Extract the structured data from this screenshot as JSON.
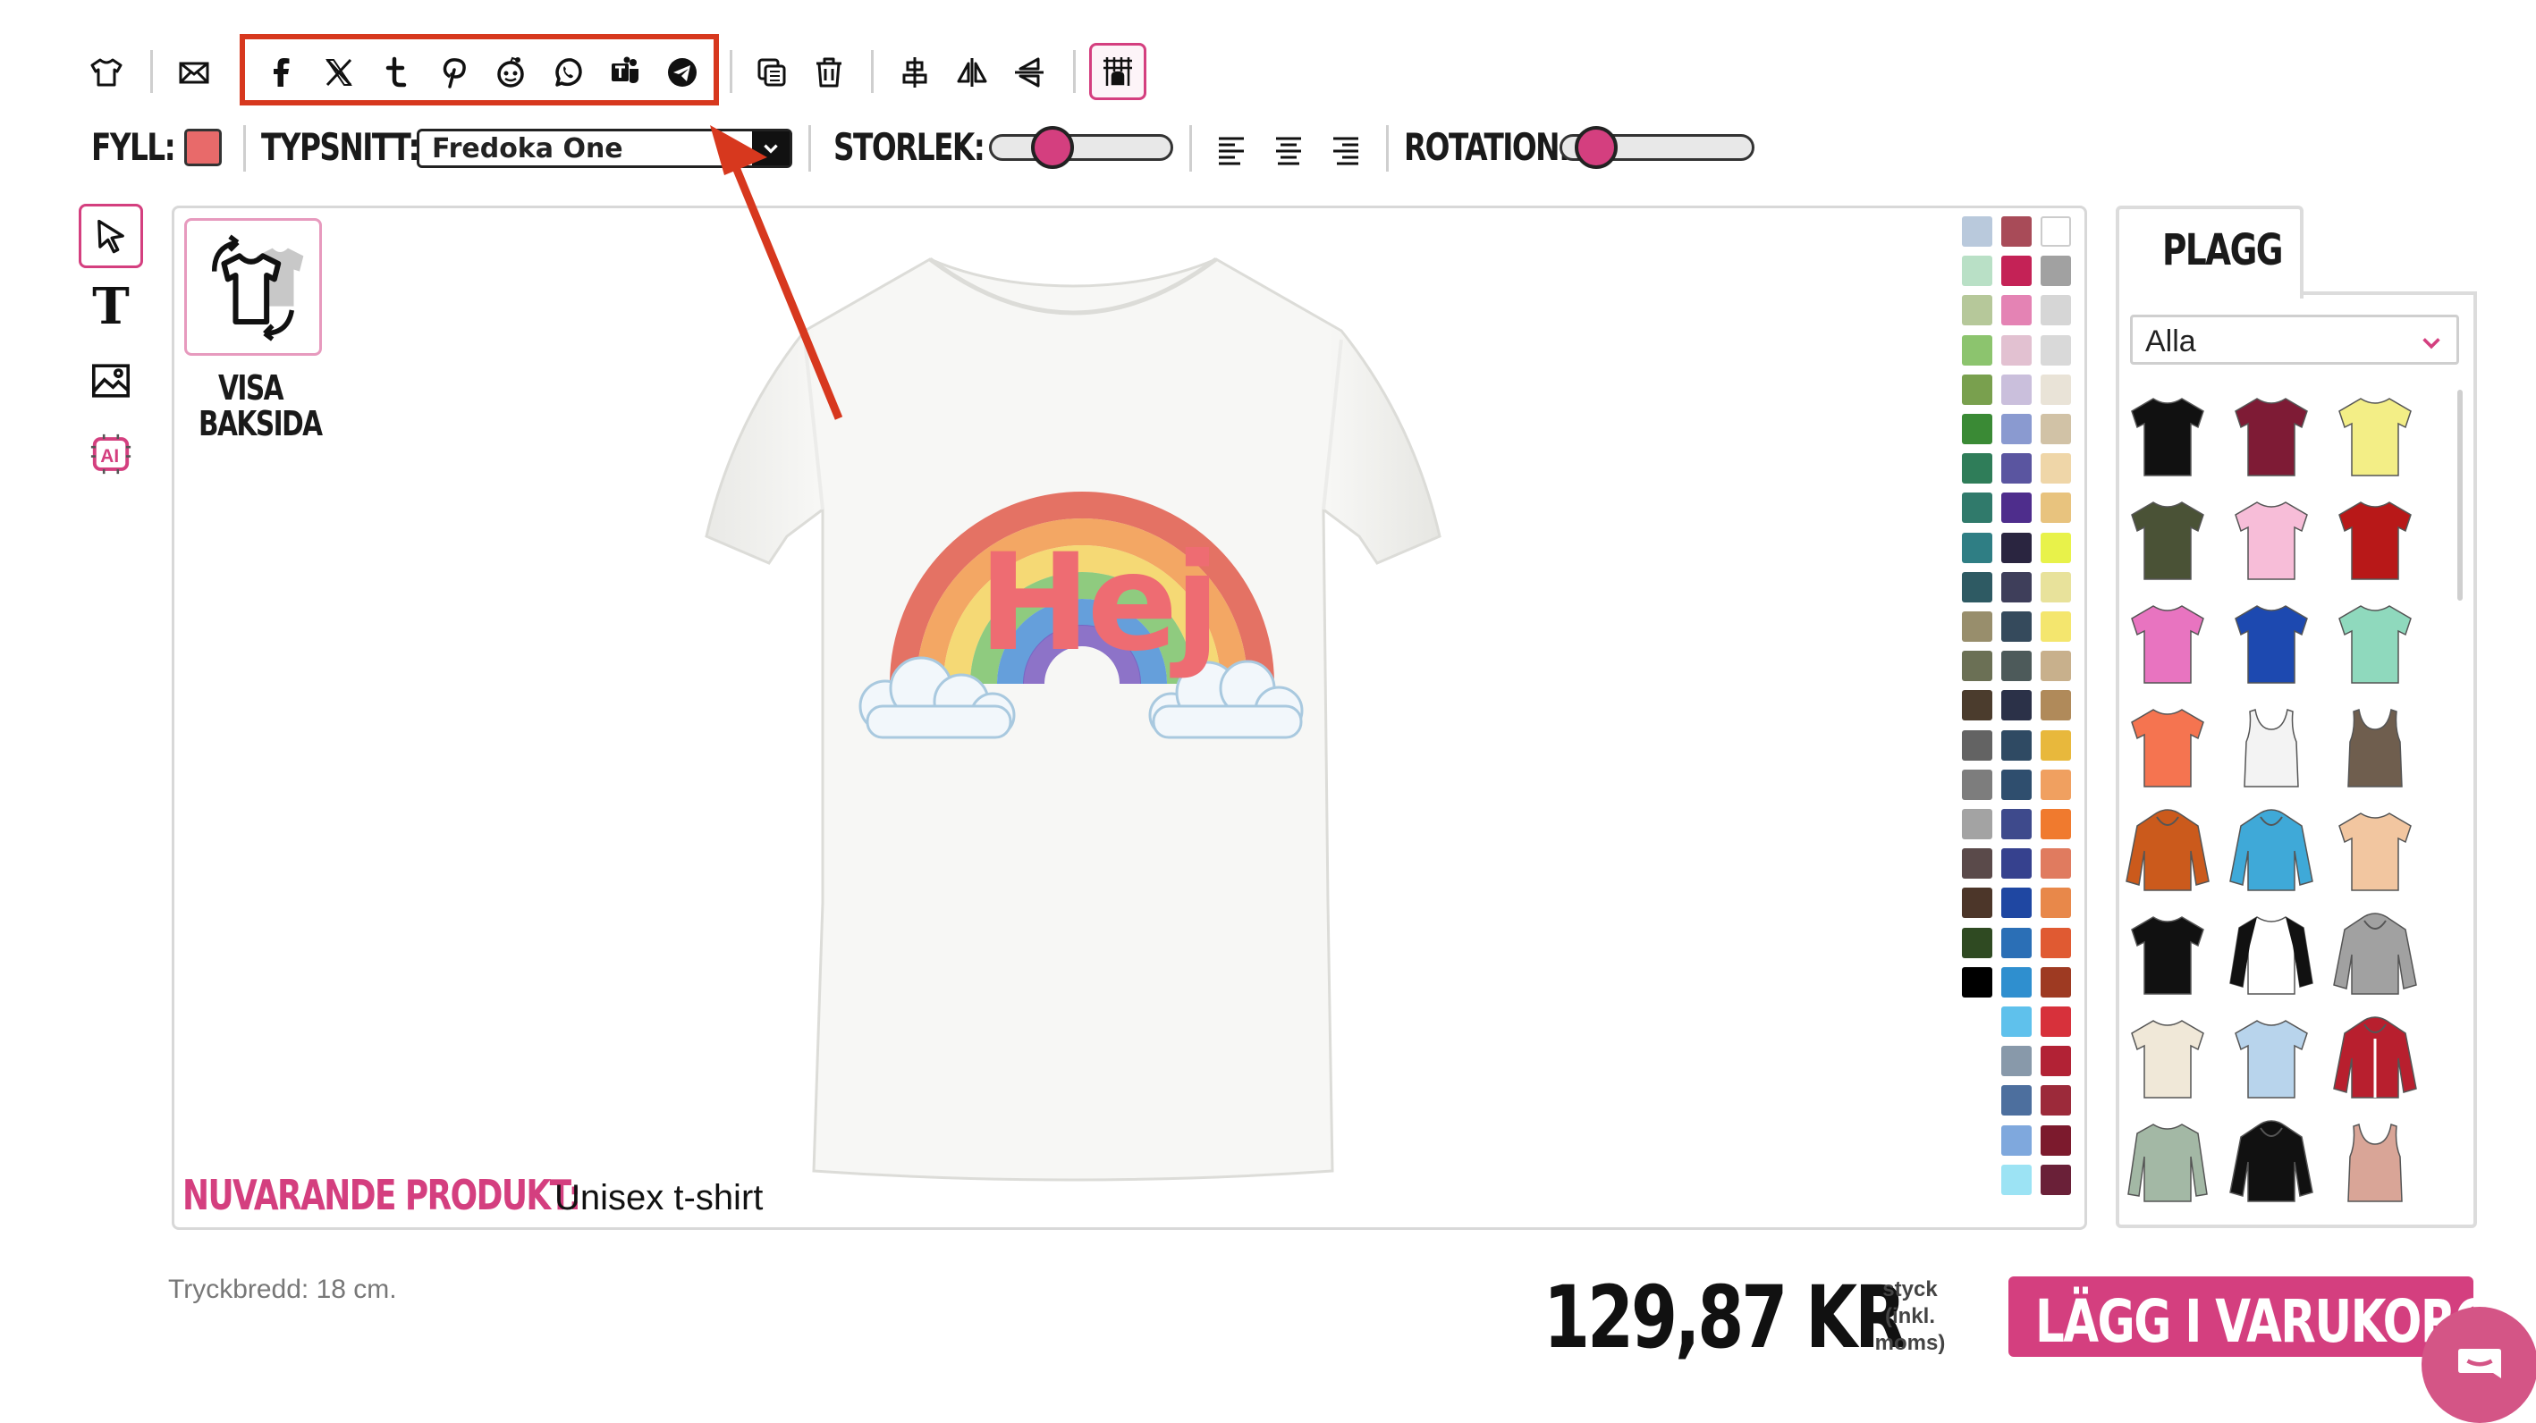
{
  "toolbar": {
    "share_icons": [
      "facebook-icon",
      "x-icon",
      "tumblr-icon",
      "pinterest-icon",
      "reddit-icon",
      "whatsapp-icon",
      "teams-icon",
      "telegram-icon"
    ]
  },
  "options": {
    "fill_label": "FYLL:",
    "fill_color": "#e86a6a",
    "font_label": "TYPSNITT:",
    "font_value": "Fredoka One",
    "size_label": "STORLEK:",
    "size_value": 0.3,
    "rotation_label": "ROTATION:",
    "rotation_value": 0.1
  },
  "canvas": {
    "back_label_line1": "VISA",
    "back_label_line2": "BAKSIDA",
    "design_text": "Hej",
    "product_label": "NUVARANDE PRODUKT:",
    "product_name": "Unisex t-shirt",
    "accent": "#d43f7f"
  },
  "palette": {
    "col1": [
      "#b9c9dc",
      "#b9e0c6",
      "#b6c89a",
      "#8cc46e",
      "#79a04e",
      "#3a8a35",
      "#2f7d59",
      "#307a6b",
      "#2f7e84",
      "#2e5a63",
      "#988e6c",
      "#6b7055",
      "#4b3c2d",
      "#636363",
      "#7d7d7d",
      "#a3a3a3",
      "#5a4a4a",
      "#4c3629",
      "#2f4a22",
      "#000000"
    ],
    "col2": [
      "#a84b58",
      "#c42256",
      "#e483b4",
      "#e2c1d1",
      "#cabfdc",
      "#8a9ad0",
      "#5a55a0",
      "#4e2d8c",
      "#2a2540",
      "#3e3e5a",
      "#354a5c",
      "#4d5a5a",
      "#2b3148",
      "#2f4a63",
      "#2f4e6e",
      "#3e4a8c",
      "#36418e",
      "#1f47a2",
      "#2b6fb6",
      "#2f8fcf",
      "#5fc1ec",
      "#8899aa",
      "#4d6f9e",
      "#7fa8dd",
      "#9ce3f4"
    ],
    "col3": [
      "#ffffff",
      "#a1a1a1",
      "#d6d6d6",
      "#d9d9d9",
      "#e9e3d7",
      "#d1c2a6",
      "#efd6a8",
      "#e8c37e",
      "#e8f24a",
      "#e8e29b",
      "#f4e66e",
      "#c8b08c",
      "#b08a5a",
      "#e8b83c",
      "#f0a060",
      "#f07a2e",
      "#e07b5f",
      "#e8884a",
      "#e05a32",
      "#9e3a22",
      "#d7313b",
      "#b22235",
      "#9c2a3a",
      "#7c1a2d",
      "#6a2038"
    ]
  },
  "garments_panel": {
    "tab_label": "PLAGG",
    "filter_value": "Alla",
    "items": [
      {
        "name": "black-tshirt",
        "color": "#111111",
        "kind": "tee"
      },
      {
        "name": "burgundy-tshirt",
        "color": "#7e1b35",
        "kind": "tee"
      },
      {
        "name": "yellow-tshirt",
        "color": "#f3ee86",
        "kind": "tee"
      },
      {
        "name": "olive-tshirt",
        "color": "#4a5236",
        "kind": "tee"
      },
      {
        "name": "pink-tshirt",
        "color": "#f7bdd8",
        "kind": "tee"
      },
      {
        "name": "red-tshirt",
        "color": "#b81818",
        "kind": "tee"
      },
      {
        "name": "magenta-tshirt",
        "color": "#e874c0",
        "kind": "tee"
      },
      {
        "name": "royal-blue-tshirt",
        "color": "#1d49b0",
        "kind": "tee"
      },
      {
        "name": "mint-tshirt",
        "color": "#8fd9bd",
        "kind": "tee"
      },
      {
        "name": "coral-tshirt",
        "color": "#f57450",
        "kind": "tee"
      },
      {
        "name": "white-tank",
        "color": "#f3f3f3",
        "kind": "tank"
      },
      {
        "name": "brown-tank",
        "color": "#6f5e4e",
        "kind": "tank"
      },
      {
        "name": "orange-hoodie",
        "color": "#cb5a1c",
        "kind": "hoodie"
      },
      {
        "name": "blue-hoodie",
        "color": "#3fa9d8",
        "kind": "hoodie"
      },
      {
        "name": "tiedye-tshirt",
        "color": "#f2c6a0",
        "kind": "tee"
      },
      {
        "name": "black-vneck",
        "color": "#111111",
        "kind": "tee"
      },
      {
        "name": "raglan-shirt",
        "color": "#ffffff",
        "kind": "raglan"
      },
      {
        "name": "grey-hoodie",
        "color": "#a1a1a1",
        "kind": "hoodie"
      },
      {
        "name": "cream-tshirt",
        "color": "#f0e8d8",
        "kind": "tee"
      },
      {
        "name": "ombre-tshirt",
        "color": "#b8d4ec",
        "kind": "tee"
      },
      {
        "name": "varsity-jacket",
        "color": "#b81f2e",
        "kind": "jacket"
      },
      {
        "name": "sage-longsleeve",
        "color": "#a3b8a5",
        "kind": "longsleeve"
      },
      {
        "name": "black-orange-hoodie",
        "color": "#111111",
        "kind": "hoodie"
      },
      {
        "name": "blush-tank",
        "color": "#d9a597",
        "kind": "tank"
      }
    ]
  },
  "footer": {
    "print_width": "Tryckbredd: 18 cm.",
    "price": "129,87 KR",
    "unit_line1": "styck",
    "unit_line2": "(inkl.",
    "unit_line3": "moms)",
    "cart_button": "LÄGG I VARUKORGEN"
  }
}
